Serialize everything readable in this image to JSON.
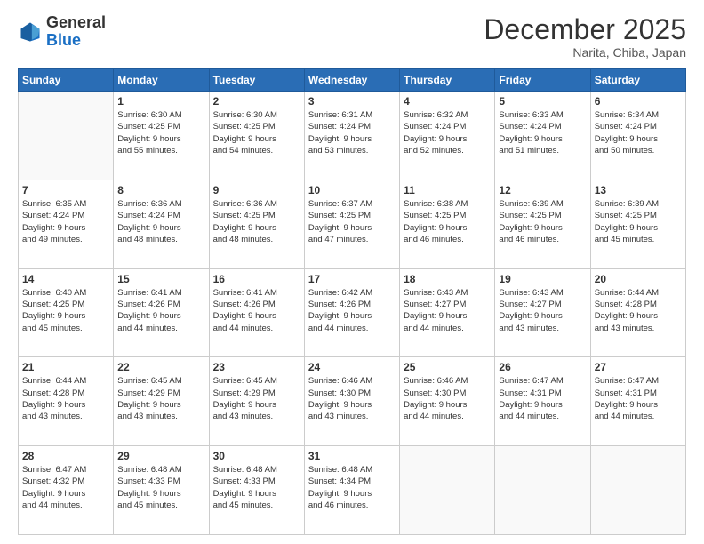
{
  "header": {
    "logo_line1": "General",
    "logo_line2": "Blue",
    "month": "December 2025",
    "location": "Narita, Chiba, Japan"
  },
  "weekdays": [
    "Sunday",
    "Monday",
    "Tuesday",
    "Wednesday",
    "Thursday",
    "Friday",
    "Saturday"
  ],
  "weeks": [
    [
      {
        "day": "",
        "info": ""
      },
      {
        "day": "1",
        "info": "Sunrise: 6:30 AM\nSunset: 4:25 PM\nDaylight: 9 hours\nand 55 minutes."
      },
      {
        "day": "2",
        "info": "Sunrise: 6:30 AM\nSunset: 4:25 PM\nDaylight: 9 hours\nand 54 minutes."
      },
      {
        "day": "3",
        "info": "Sunrise: 6:31 AM\nSunset: 4:24 PM\nDaylight: 9 hours\nand 53 minutes."
      },
      {
        "day": "4",
        "info": "Sunrise: 6:32 AM\nSunset: 4:24 PM\nDaylight: 9 hours\nand 52 minutes."
      },
      {
        "day": "5",
        "info": "Sunrise: 6:33 AM\nSunset: 4:24 PM\nDaylight: 9 hours\nand 51 minutes."
      },
      {
        "day": "6",
        "info": "Sunrise: 6:34 AM\nSunset: 4:24 PM\nDaylight: 9 hours\nand 50 minutes."
      }
    ],
    [
      {
        "day": "7",
        "info": "Sunrise: 6:35 AM\nSunset: 4:24 PM\nDaylight: 9 hours\nand 49 minutes."
      },
      {
        "day": "8",
        "info": "Sunrise: 6:36 AM\nSunset: 4:24 PM\nDaylight: 9 hours\nand 48 minutes."
      },
      {
        "day": "9",
        "info": "Sunrise: 6:36 AM\nSunset: 4:25 PM\nDaylight: 9 hours\nand 48 minutes."
      },
      {
        "day": "10",
        "info": "Sunrise: 6:37 AM\nSunset: 4:25 PM\nDaylight: 9 hours\nand 47 minutes."
      },
      {
        "day": "11",
        "info": "Sunrise: 6:38 AM\nSunset: 4:25 PM\nDaylight: 9 hours\nand 46 minutes."
      },
      {
        "day": "12",
        "info": "Sunrise: 6:39 AM\nSunset: 4:25 PM\nDaylight: 9 hours\nand 46 minutes."
      },
      {
        "day": "13",
        "info": "Sunrise: 6:39 AM\nSunset: 4:25 PM\nDaylight: 9 hours\nand 45 minutes."
      }
    ],
    [
      {
        "day": "14",
        "info": "Sunrise: 6:40 AM\nSunset: 4:25 PM\nDaylight: 9 hours\nand 45 minutes."
      },
      {
        "day": "15",
        "info": "Sunrise: 6:41 AM\nSunset: 4:26 PM\nDaylight: 9 hours\nand 44 minutes."
      },
      {
        "day": "16",
        "info": "Sunrise: 6:41 AM\nSunset: 4:26 PM\nDaylight: 9 hours\nand 44 minutes."
      },
      {
        "day": "17",
        "info": "Sunrise: 6:42 AM\nSunset: 4:26 PM\nDaylight: 9 hours\nand 44 minutes."
      },
      {
        "day": "18",
        "info": "Sunrise: 6:43 AM\nSunset: 4:27 PM\nDaylight: 9 hours\nand 44 minutes."
      },
      {
        "day": "19",
        "info": "Sunrise: 6:43 AM\nSunset: 4:27 PM\nDaylight: 9 hours\nand 43 minutes."
      },
      {
        "day": "20",
        "info": "Sunrise: 6:44 AM\nSunset: 4:28 PM\nDaylight: 9 hours\nand 43 minutes."
      }
    ],
    [
      {
        "day": "21",
        "info": "Sunrise: 6:44 AM\nSunset: 4:28 PM\nDaylight: 9 hours\nand 43 minutes."
      },
      {
        "day": "22",
        "info": "Sunrise: 6:45 AM\nSunset: 4:29 PM\nDaylight: 9 hours\nand 43 minutes."
      },
      {
        "day": "23",
        "info": "Sunrise: 6:45 AM\nSunset: 4:29 PM\nDaylight: 9 hours\nand 43 minutes."
      },
      {
        "day": "24",
        "info": "Sunrise: 6:46 AM\nSunset: 4:30 PM\nDaylight: 9 hours\nand 43 minutes."
      },
      {
        "day": "25",
        "info": "Sunrise: 6:46 AM\nSunset: 4:30 PM\nDaylight: 9 hours\nand 44 minutes."
      },
      {
        "day": "26",
        "info": "Sunrise: 6:47 AM\nSunset: 4:31 PM\nDaylight: 9 hours\nand 44 minutes."
      },
      {
        "day": "27",
        "info": "Sunrise: 6:47 AM\nSunset: 4:31 PM\nDaylight: 9 hours\nand 44 minutes."
      }
    ],
    [
      {
        "day": "28",
        "info": "Sunrise: 6:47 AM\nSunset: 4:32 PM\nDaylight: 9 hours\nand 44 minutes."
      },
      {
        "day": "29",
        "info": "Sunrise: 6:48 AM\nSunset: 4:33 PM\nDaylight: 9 hours\nand 45 minutes."
      },
      {
        "day": "30",
        "info": "Sunrise: 6:48 AM\nSunset: 4:33 PM\nDaylight: 9 hours\nand 45 minutes."
      },
      {
        "day": "31",
        "info": "Sunrise: 6:48 AM\nSunset: 4:34 PM\nDaylight: 9 hours\nand 46 minutes."
      },
      {
        "day": "",
        "info": ""
      },
      {
        "day": "",
        "info": ""
      },
      {
        "day": "",
        "info": ""
      }
    ]
  ]
}
